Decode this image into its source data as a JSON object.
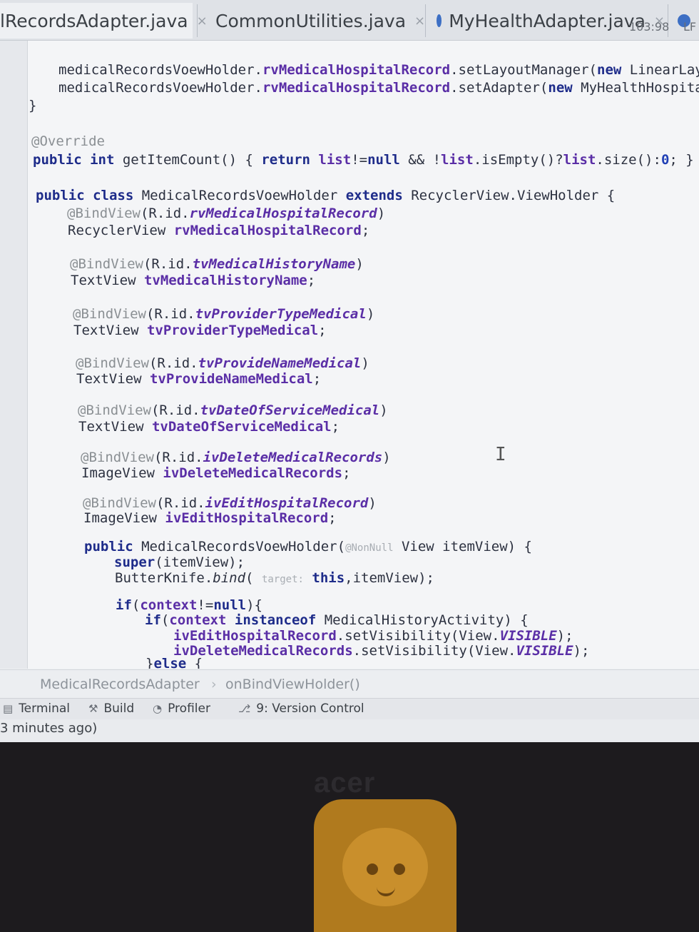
{
  "tabs": [
    {
      "label": "lRecordsAdapter.java",
      "active": true,
      "close": "×"
    },
    {
      "label": "CommonUtilities.java",
      "active": false,
      "close": "×"
    },
    {
      "label": "MyHealthAdapter.java",
      "active": false,
      "close": "×"
    }
  ],
  "code": {
    "line1": [
      "medicalRecordsVoewHolder.",
      "rvMedicalHospitalRecord",
      ".setLayoutManager(",
      "new",
      " LinearLay"
    ],
    "line2": [
      "medicalRecordsVoewHolder.",
      "rvMedicalHospitalRecord",
      ".setAdapter(",
      "new",
      " MyHealthHospita"
    ],
    "line3": "}",
    "line4": "@Override",
    "line5": [
      "public",
      " ",
      "int",
      " getItemCount() { ",
      "return",
      " ",
      "list",
      "!=",
      "null",
      " && !",
      "list",
      ".isEmpty()?",
      "list",
      ".size():",
      "0",
      "; }"
    ],
    "line6": [
      "public",
      " ",
      "class",
      " MedicalRecordsVoewHolder ",
      "extends",
      " RecyclerView.ViewHolder {"
    ],
    "bind1": [
      "@BindView",
      "(R.id.",
      "rvMedicalHospitalRecord",
      ")"
    ],
    "decl1": [
      "RecyclerView ",
      "rvMedicalHospitalRecord",
      ";"
    ],
    "bind2": [
      "@BindView",
      "(R.id.",
      "tvMedicalHistoryName",
      ")"
    ],
    "decl2": [
      "TextView ",
      "tvMedicalHistoryName",
      ";"
    ],
    "bind3": [
      "@BindView",
      "(R.id.",
      "tvProviderTypeMedical",
      ")"
    ],
    "decl3": [
      "TextView ",
      "tvProviderTypeMedical",
      ";"
    ],
    "bind4": [
      "@BindView",
      "(R.id.",
      "tvProvideNameMedical",
      ")"
    ],
    "decl4": [
      "TextView ",
      "tvProvideNameMedical",
      ";"
    ],
    "bind5": [
      "@BindView",
      "(R.id.",
      "tvDateOfServiceMedical",
      ")"
    ],
    "decl5": [
      "TextView ",
      "tvDateOfServiceMedical",
      ";"
    ],
    "bind6": [
      "@BindView",
      "(R.id.",
      "ivDeleteMedicalRecords",
      ")"
    ],
    "decl6": [
      "ImageView ",
      "ivDeleteMedicalRecords",
      ";"
    ],
    "bind7": [
      "@BindView",
      "(R.id.",
      "ivEditHospitalRecord",
      ")"
    ],
    "decl7": [
      "ImageView ",
      "ivEditHospitalRecord",
      ";"
    ],
    "ctor": [
      "public",
      " MedicalRecordsVoewHolder(",
      "@NonNull",
      " View itemView) {"
    ],
    "super": [
      "super",
      "(itemView);"
    ],
    "bind": [
      "ButterKnife.",
      "bind",
      "( ",
      "target:",
      " ",
      "this",
      ",itemView);"
    ],
    "if1": [
      "if",
      "(",
      "context",
      "!=",
      "null",
      "){"
    ],
    "if2": [
      "if",
      "(",
      "context",
      " ",
      "instanceof",
      " MedicalHistoryActivity) {"
    ],
    "set1": [
      "ivEditHospitalRecord",
      ".setVisibility(View.",
      "VISIBLE",
      ");"
    ],
    "set2": [
      "ivDeleteMedicalRecords",
      ".setVisibility(View.",
      "VISIBLE",
      ");"
    ],
    "else": [
      "}",
      "else",
      " {"
    ]
  },
  "breadcrumb": {
    "class": "MedicalRecordsAdapter",
    "sep": "›",
    "method": "onBindViewHolder()"
  },
  "tools": {
    "terminal": "Terminal",
    "build": "Build",
    "profiler": "Profiler",
    "vcs": "9: Version Control"
  },
  "status": {
    "left": "3 minutes ago)",
    "position": "103:98",
    "lf": "LF"
  },
  "laptop": {
    "brand": "acer"
  },
  "colors": {
    "keyword": "#1e2c8a",
    "field": "#5a2ea6",
    "annotation": "#8a8f93",
    "number": "#1f3fb5",
    "tab_dot": "#3d6fc4"
  }
}
